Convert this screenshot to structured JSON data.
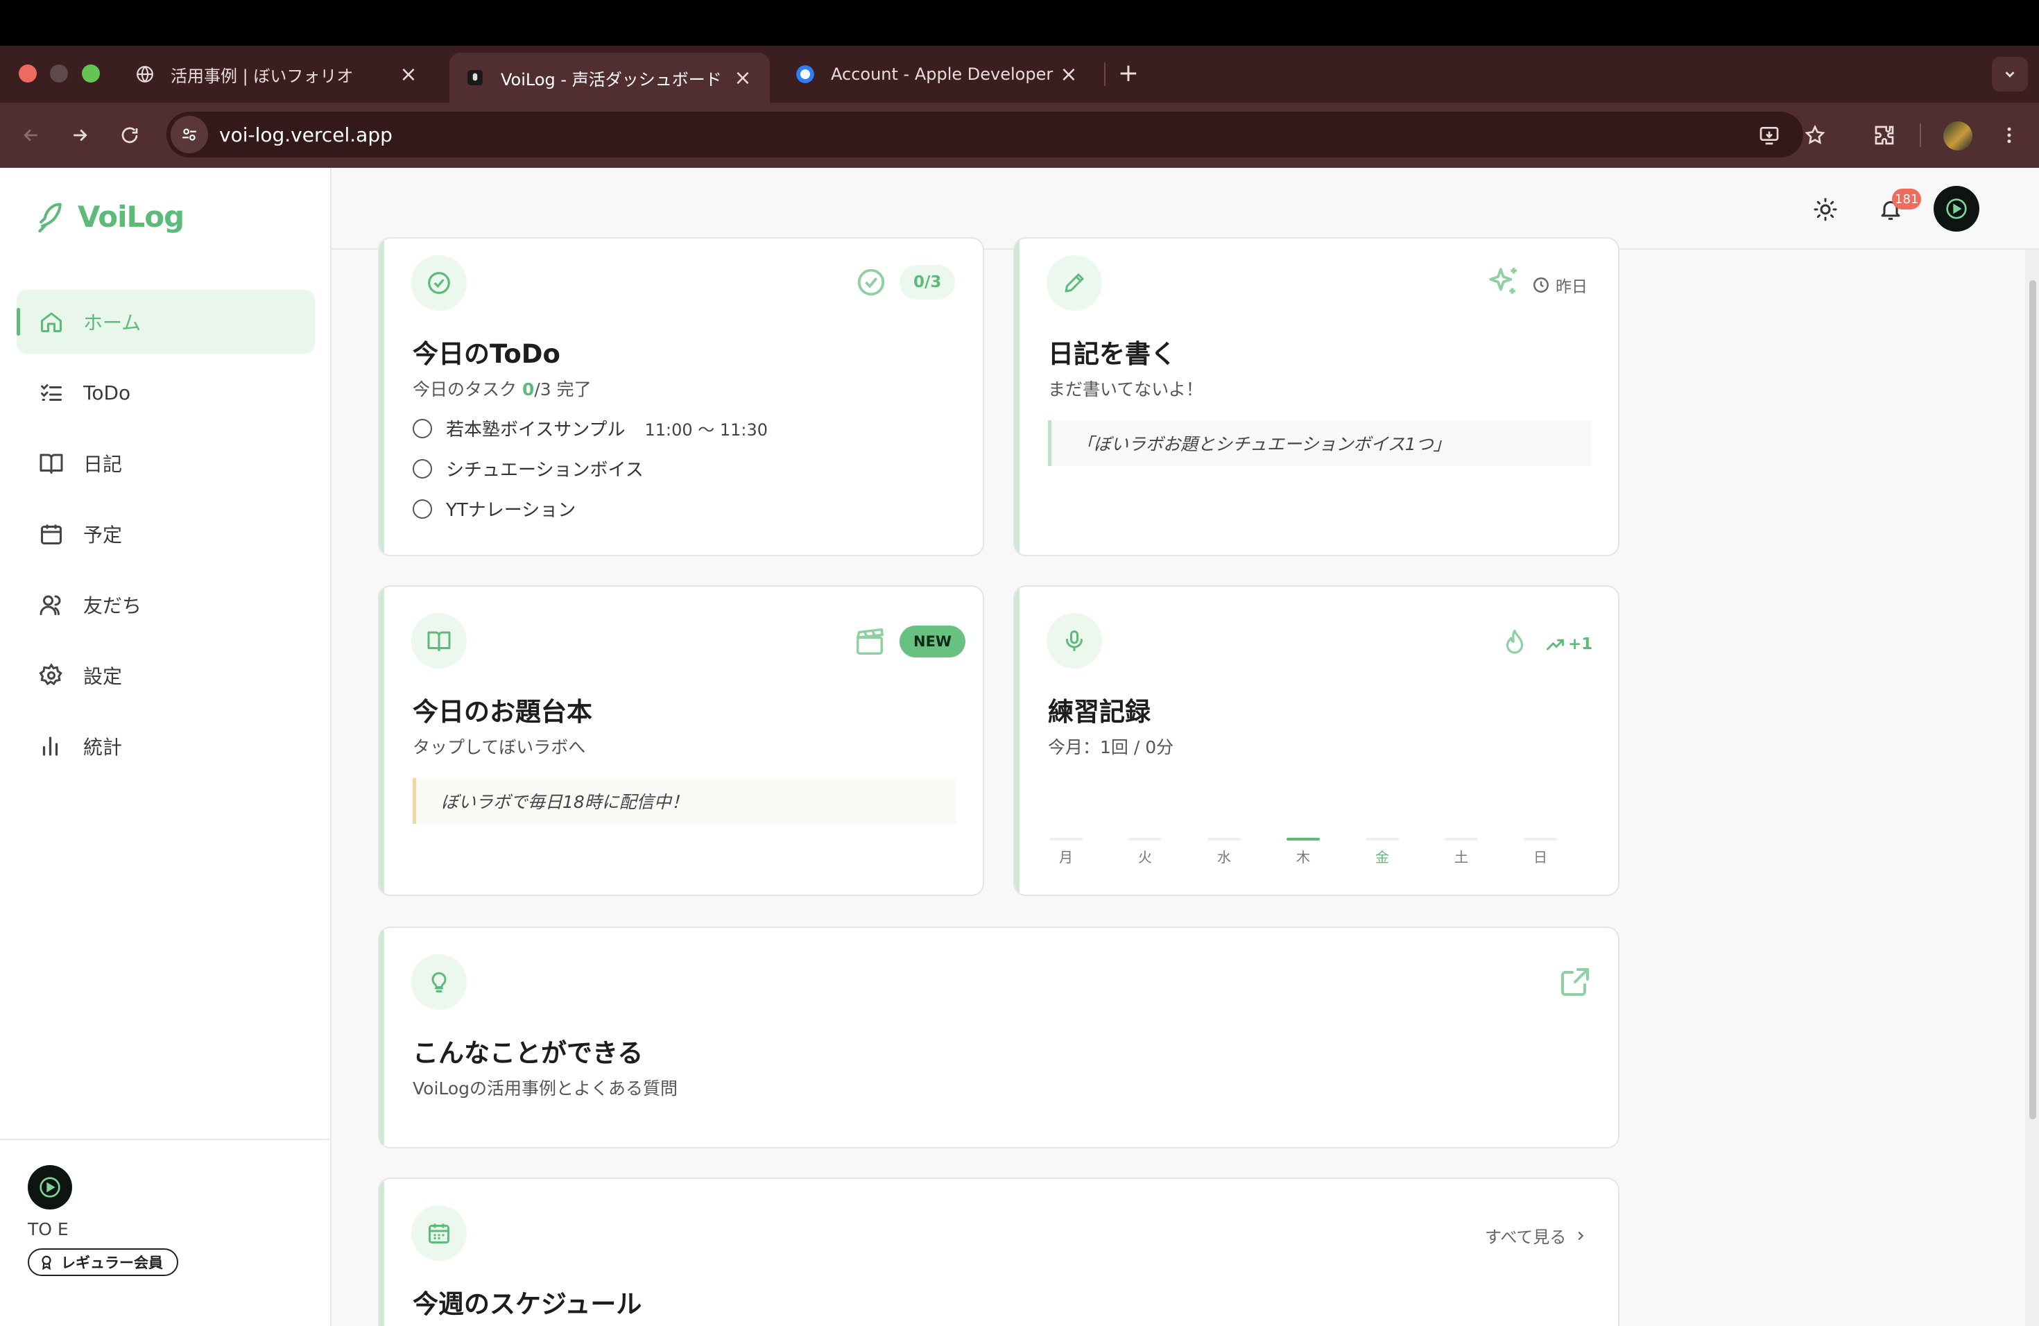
{
  "browser": {
    "tabs": [
      {
        "title": "活用事例 | ぼいフォリオ",
        "icon": "globe-icon"
      },
      {
        "title": "VoiLog - 声活ダッシュボード",
        "icon": "voilog-favicon"
      },
      {
        "title": "Account - Apple Developer",
        "icon": "apple-dev-favicon"
      }
    ],
    "url": "voi-log.vercel.app"
  },
  "sidebar": {
    "logo": "VoiLog",
    "items": [
      {
        "label": "ホーム",
        "icon": "home-icon"
      },
      {
        "label": "ToDo",
        "icon": "list-check-icon"
      },
      {
        "label": "日記",
        "icon": "book-icon"
      },
      {
        "label": "予定",
        "icon": "calendar-icon"
      },
      {
        "label": "友だち",
        "icon": "users-icon"
      },
      {
        "label": "設定",
        "icon": "gear-icon"
      },
      {
        "label": "統計",
        "icon": "bar-chart-icon"
      }
    ],
    "user": {
      "name": "TO E",
      "badge": "レギュラー会員"
    }
  },
  "header": {
    "notification_count": "181"
  },
  "cards": {
    "todo": {
      "count": "0/3",
      "title": "今日のToDo",
      "sub_prefix": "今日のタスク ",
      "sub_done": "0",
      "sub_total": "/3",
      "sub_suffix": " 完了",
      "items": [
        {
          "label": "若本塾ボイスサンプル",
          "time": "11:00 〜 11:30"
        },
        {
          "label": "シチュエーションボイス",
          "time": ""
        },
        {
          "label": "YTナレーション",
          "time": ""
        }
      ]
    },
    "diary": {
      "meta": "昨日",
      "title": "日記を書く",
      "sub": "まだ書いてないよ！",
      "quote": "「ぼいラボお題とシチュエーションボイス1つ」"
    },
    "script": {
      "badge": "NEW",
      "title": "今日のお題台本",
      "sub": "タップしてぼいラボへ",
      "quote": "ぼいラボで毎日18時に配信中！"
    },
    "practice": {
      "trend": "+1",
      "title": "練習記録",
      "sub": "今月：1回 / 0分",
      "days": [
        "月",
        "火",
        "水",
        "木",
        "金",
        "土",
        "日"
      ],
      "today": "金",
      "active_day": "木"
    },
    "features": {
      "title": "こんなことができる",
      "sub": "VoiLogの活用事例とよくある質問"
    },
    "schedule": {
      "title": "今週のスケジュール",
      "see_all": "すべて見る"
    }
  },
  "colors": {
    "accent": "#5dbb7a",
    "tab_bar": "#3b1f20",
    "toolbar": "#512f30",
    "badge_red": "#ef6b5d"
  }
}
